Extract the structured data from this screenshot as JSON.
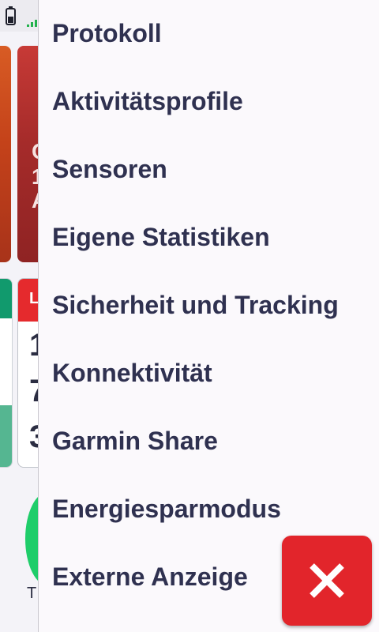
{
  "menu": {
    "items": [
      {
        "label": "Protokoll"
      },
      {
        "label": "Aktivitätsprofile"
      },
      {
        "label": "Sensoren"
      },
      {
        "label": "Eigene Statistiken"
      },
      {
        "label": "Sicherheit und Tracking"
      },
      {
        "label": "Konnektivität"
      },
      {
        "label": "Garmin Share"
      },
      {
        "label": "Energiesparmodus"
      },
      {
        "label": "Externe Anzeige"
      }
    ]
  },
  "close_button": {
    "icon": "close-icon"
  },
  "background": {
    "card_red_glyphs": [
      "C",
      "1",
      "A"
    ],
    "card_white_header": "L",
    "card_white_digits": [
      "1",
      "7",
      "3"
    ],
    "bottom_letter": "T",
    "colors": {
      "accent_red": "#e2252b",
      "menu_text": "#2f3150",
      "green": "#1fcd6a"
    }
  }
}
